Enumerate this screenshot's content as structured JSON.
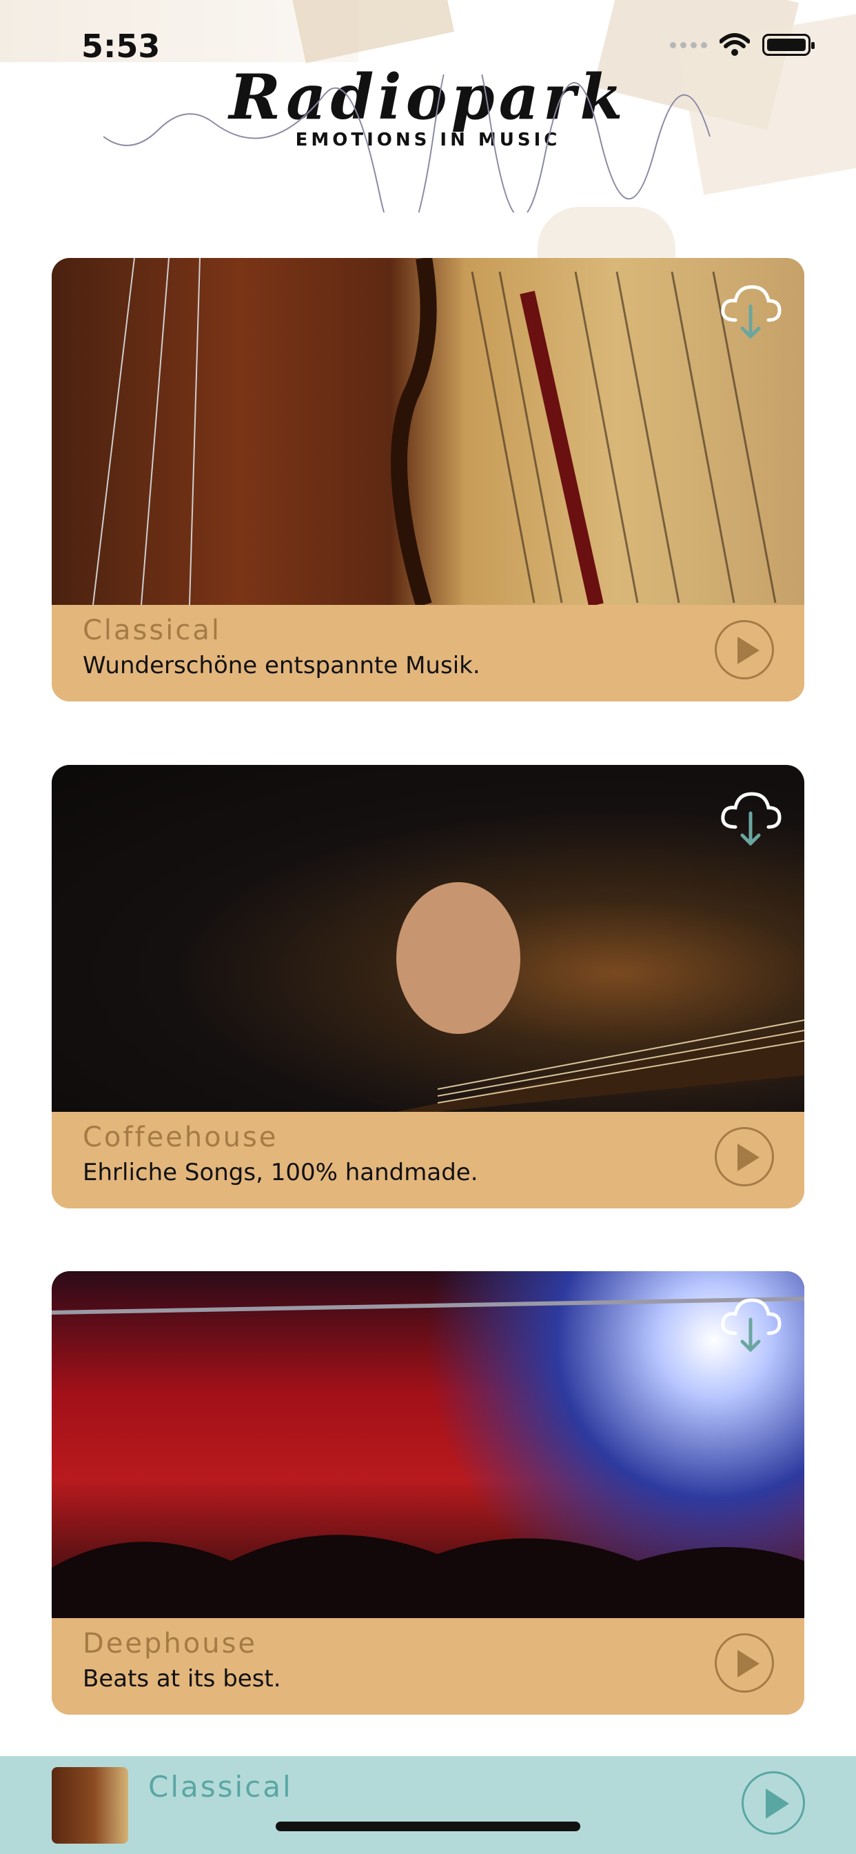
{
  "status_bar": {
    "time": "5:53"
  },
  "header": {
    "logo_title": "Radiopark",
    "logo_subtitle": "EMOTIONS IN MUSIC"
  },
  "stations": [
    {
      "title": "Classical",
      "description": "Wunderschöne entspannte Musik.",
      "image": "violin-and-sheet-music",
      "icon": "cloud-download-icon"
    },
    {
      "title": "Coffeehouse",
      "description": "Ehrliche Songs, 100% handmade.",
      "image": "acoustic-guitar-hand",
      "icon": "cloud-download-icon"
    },
    {
      "title": "Deephouse",
      "description": "Beats at its best.",
      "image": "concert-confetti-crowd",
      "icon": "cloud-download-icon"
    }
  ],
  "mini_player": {
    "title": "Classical",
    "thumbnail": "violin-and-sheet-music"
  },
  "colors": {
    "card_bg": "#e3b67c",
    "card_title": "#a57b45",
    "player_bg": "#b3dad9",
    "player_accent": "#5aa6a3",
    "download_arrow": "#6aa6a0"
  }
}
